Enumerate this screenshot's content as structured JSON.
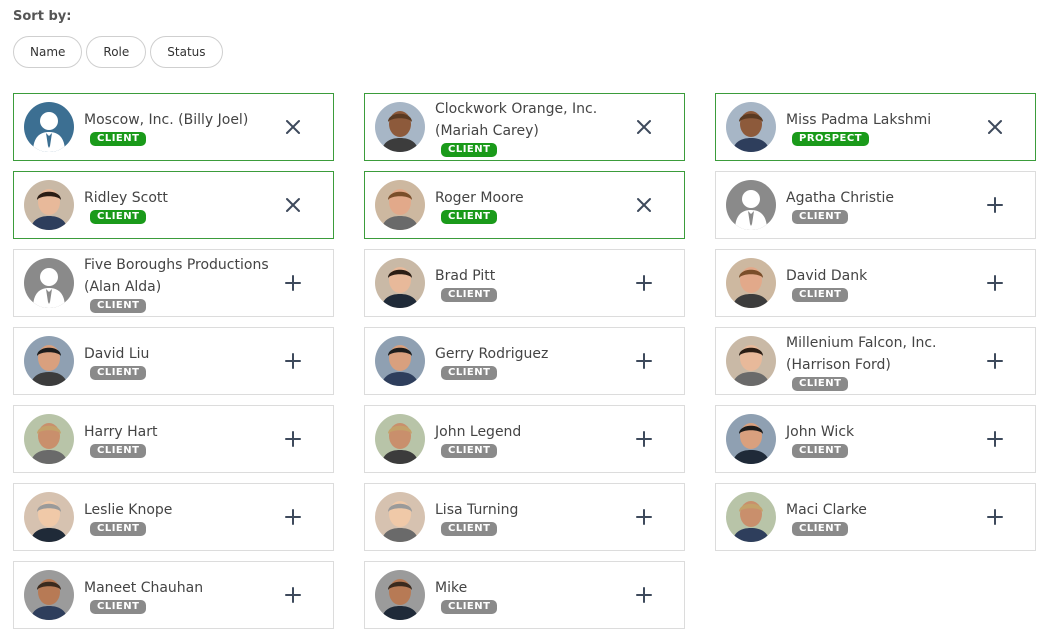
{
  "sort": {
    "label": "Sort by:",
    "options": [
      "Name",
      "Role",
      "Status"
    ]
  },
  "colors": {
    "selected_border": "#3b9c3b",
    "badge_active": "#1a9a1a",
    "badge_client": "#8a8a8a"
  },
  "columns": [
    [
      {
        "name": "Moscow, Inc. (Billy Joel)",
        "badge": "CLIENT",
        "selected": true,
        "action": "remove",
        "avatar": "placeholder-avatar-blue"
      },
      {
        "name": "Ridley Scott",
        "badge": "CLIENT",
        "selected": true,
        "action": "remove",
        "avatar": "photo-avatar"
      },
      {
        "name": "Five Boroughs Productions (Alan Alda)",
        "badge": "CLIENT",
        "selected": false,
        "action": "add",
        "avatar": "placeholder-avatar-gray"
      },
      {
        "name": "David Liu",
        "badge": "CLIENT",
        "selected": false,
        "action": "add",
        "avatar": "photo-avatar"
      },
      {
        "name": "Harry Hart",
        "badge": "CLIENT",
        "selected": false,
        "action": "add",
        "avatar": "photo-avatar"
      },
      {
        "name": "Leslie Knope",
        "badge": "CLIENT",
        "selected": false,
        "action": "add",
        "avatar": "photo-avatar"
      },
      {
        "name": "Maneet Chauhan",
        "badge": "CLIENT",
        "selected": false,
        "action": "add",
        "avatar": "photo-avatar"
      }
    ],
    [
      {
        "name": "Clockwork Orange, Inc. (Mariah Carey)",
        "badge": "CLIENT",
        "selected": true,
        "action": "remove",
        "avatar": "photo-avatar"
      },
      {
        "name": "Roger Moore",
        "badge": "CLIENT",
        "selected": true,
        "action": "remove",
        "avatar": "photo-avatar"
      },
      {
        "name": "Brad Pitt",
        "badge": "CLIENT",
        "selected": false,
        "action": "add",
        "avatar": "photo-avatar"
      },
      {
        "name": "Gerry Rodriguez",
        "badge": "CLIENT",
        "selected": false,
        "action": "add",
        "avatar": "photo-avatar"
      },
      {
        "name": "John Legend",
        "badge": "CLIENT",
        "selected": false,
        "action": "add",
        "avatar": "photo-avatar"
      },
      {
        "name": "Lisa Turning",
        "badge": "CLIENT",
        "selected": false,
        "action": "add",
        "avatar": "photo-avatar"
      },
      {
        "name": "Mike",
        "badge": "CLIENT",
        "selected": false,
        "action": "add",
        "avatar": "photo-avatar"
      }
    ],
    [
      {
        "name": "Miss Padma Lakshmi",
        "badge": "PROSPECT",
        "selected": true,
        "action": "remove",
        "avatar": "photo-avatar"
      },
      {
        "name": "Agatha Christie",
        "badge": "CLIENT",
        "selected": false,
        "action": "add",
        "avatar": "placeholder-avatar-gray"
      },
      {
        "name": "David Dank",
        "badge": "CLIENT",
        "selected": false,
        "action": "add",
        "avatar": "photo-avatar"
      },
      {
        "name": "Millenium Falcon, Inc. (Harrison Ford)",
        "badge": "CLIENT",
        "selected": false,
        "action": "add",
        "avatar": "photo-avatar"
      },
      {
        "name": "John Wick",
        "badge": "CLIENT",
        "selected": false,
        "action": "add",
        "avatar": "photo-avatar"
      },
      {
        "name": "Maci Clarke",
        "badge": "CLIENT",
        "selected": false,
        "action": "add",
        "avatar": "photo-avatar"
      }
    ]
  ]
}
